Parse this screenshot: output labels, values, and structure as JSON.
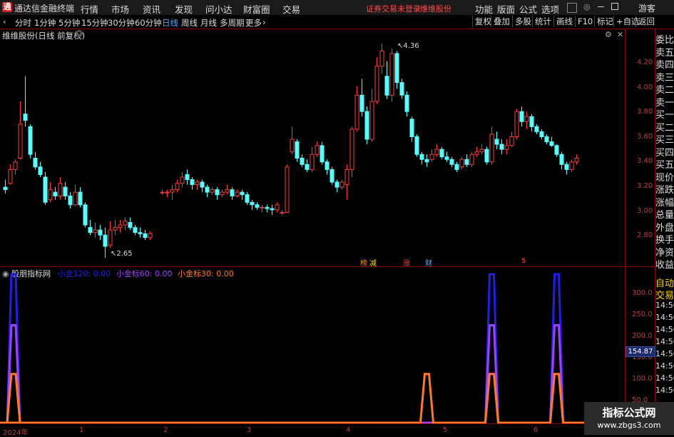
{
  "titlebar": {
    "app_title": "通达信金融终端",
    "menu": [
      "行情",
      "市场",
      "资讯",
      "发现",
      "问小达",
      "财富圈",
      "交易"
    ],
    "status_text": "证券交易未登录",
    "stock_name": "维维股份",
    "right_menu": [
      "功能",
      "版面",
      "公式",
      "选项"
    ],
    "guest": "游客"
  },
  "periods": [
    "分时",
    "1分钟",
    "5分钟",
    "15分钟",
    "30分钟",
    "60分钟",
    "日线",
    "周线",
    "月线",
    "多周期",
    "更多"
  ],
  "active_period": "日线",
  "toolbar_right": [
    "复权",
    "叠加",
    "多股",
    "统计",
    "画线",
    "F10",
    "标记",
    "+自选",
    "返回"
  ],
  "main_chart_title": "维维股份(日线 前复权)",
  "price_axis": [
    "4.20",
    "4.00",
    "3.80",
    "3.60",
    "3.40",
    "3.20",
    "3.00",
    "2.80"
  ],
  "high_label": "4.36",
  "low_label": "2.65",
  "event_tags": [
    {
      "text": "榜",
      "color": "#ff8c00"
    },
    {
      "text": "减",
      "color": "#ffd700"
    },
    {
      "text": "涨",
      "color": "#ff4040"
    },
    {
      "text": "财",
      "color": "#6fa8ff"
    },
    {
      "text": "$",
      "color": "#ff4040"
    }
  ],
  "right_panel": {
    "labels": [
      "委比",
      "卖五",
      "卖四",
      "卖三",
      "卖二",
      "卖一",
      "买一",
      "买二",
      "买三",
      "买四",
      "买五",
      "现价",
      "涨跌",
      "涨幅",
      "总量",
      "外盘",
      "换手",
      "净资",
      "收益"
    ],
    "auto_trade": [
      "自动",
      "交易"
    ],
    "times": [
      "14:56",
      "14:56",
      "14:56",
      "14:56",
      "14:56",
      "14:56",
      "14:56",
      "14:56"
    ]
  },
  "indicator": {
    "name": "股朋指标网",
    "s1_label": "小金120: 0.00",
    "s2_label": "小金标60: 0.00",
    "s3_label": "小金标30: 0.00",
    "axis": [
      "300.0",
      "250.0",
      "200.0",
      "150.0",
      "100.0",
      "50.0"
    ],
    "current_value": "154.87",
    "colors": {
      "s1": "#1e1ef0",
      "s2": "#a040ff",
      "s3": "#ff7a20"
    }
  },
  "x_axis": [
    "2024年",
    "1",
    "2",
    "3",
    "4",
    "5",
    "6"
  ],
  "watermark": {
    "line1": "指标公式网",
    "line2": "www.zbgs3.com"
  },
  "chart_data": {
    "type": "candlestick",
    "title": "维维股份(日线 前复权)",
    "ylim": [
      2.62,
      4.45
    ],
    "candles": [
      [
        3.22,
        3.2,
        3.28,
        3.17
      ],
      [
        3.25,
        3.36,
        3.4,
        3.24
      ],
      [
        3.36,
        3.42,
        3.44,
        3.32
      ],
      [
        3.45,
        3.72,
        3.9,
        3.44
      ],
      [
        3.8,
        3.75,
        4.1,
        3.7
      ],
      [
        3.7,
        3.48,
        3.72,
        3.45
      ],
      [
        3.45,
        3.38,
        3.5,
        3.36
      ],
      [
        3.38,
        3.32,
        3.42,
        3.3
      ],
      [
        3.3,
        3.1,
        3.34,
        3.08
      ],
      [
        3.12,
        3.2,
        3.26,
        3.1
      ],
      [
        3.18,
        3.15,
        3.22,
        3.12
      ],
      [
        3.15,
        3.25,
        3.3,
        3.12
      ],
      [
        3.22,
        3.15,
        3.26,
        3.12
      ],
      [
        3.15,
        3.08,
        3.18,
        3.05
      ],
      [
        3.08,
        3.18,
        3.24,
        3.07
      ],
      [
        3.18,
        3.08,
        3.22,
        3.06
      ],
      [
        3.08,
        2.92,
        3.1,
        2.9
      ],
      [
        2.9,
        2.86,
        2.96,
        2.84
      ],
      [
        2.86,
        2.88,
        2.94,
        2.82
      ],
      [
        2.88,
        2.84,
        2.92,
        2.8
      ],
      [
        2.84,
        2.75,
        2.9,
        2.66
      ],
      [
        2.76,
        2.88,
        2.95,
        2.74
      ],
      [
        2.88,
        2.9,
        2.96,
        2.84
      ],
      [
        2.9,
        2.92,
        2.96,
        2.86
      ],
      [
        2.92,
        2.95,
        2.98,
        2.88
      ],
      [
        2.94,
        2.9,
        2.98,
        2.88
      ],
      [
        2.9,
        2.86,
        2.92,
        2.84
      ],
      [
        2.86,
        2.85,
        2.9,
        2.82
      ],
      [
        2.85,
        2.82,
        2.88,
        2.8
      ],
      [
        2.82,
        2.85,
        2.87,
        2.8
      ],
      [
        3.18,
        3.18,
        3.2,
        3.16
      ],
      [
        3.18,
        3.18,
        3.2,
        3.14
      ],
      [
        3.18,
        3.2,
        3.24,
        3.12
      ],
      [
        3.2,
        3.25,
        3.28,
        3.18
      ],
      [
        3.25,
        3.3,
        3.34,
        3.22
      ],
      [
        3.32,
        3.28,
        3.36,
        3.24
      ],
      [
        3.28,
        3.24,
        3.3,
        3.2
      ],
      [
        3.24,
        3.26,
        3.28,
        3.2
      ],
      [
        3.26,
        3.22,
        3.28,
        3.18
      ],
      [
        3.22,
        3.18,
        3.24,
        3.14
      ],
      [
        3.18,
        3.2,
        3.22,
        3.16
      ],
      [
        3.2,
        3.16,
        3.22,
        3.12
      ],
      [
        3.16,
        3.18,
        3.2,
        3.14
      ],
      [
        3.18,
        3.2,
        3.24,
        3.16
      ],
      [
        3.2,
        3.15,
        3.22,
        3.12
      ],
      [
        3.15,
        3.18,
        3.2,
        3.14
      ],
      [
        3.18,
        3.16,
        3.2,
        3.12
      ],
      [
        3.16,
        3.1,
        3.18,
        3.08
      ],
      [
        3.1,
        3.08,
        3.12,
        3.04
      ],
      [
        3.08,
        3.06,
        3.1,
        3.04
      ],
      [
        3.06,
        3.06,
        3.08,
        3.02
      ],
      [
        3.06,
        3.05,
        3.08,
        3.02
      ],
      [
        3.05,
        3.04,
        3.08,
        3.0
      ],
      [
        3.04,
        3.08,
        3.1,
        3.02
      ],
      [
        3.02,
        3.02,
        3.04,
        3.0
      ],
      [
        3.02,
        3.38,
        3.4,
        3.02
      ],
      [
        3.5,
        3.6,
        3.7,
        3.48
      ],
      [
        3.58,
        3.45,
        3.6,
        3.42
      ],
      [
        3.45,
        3.4,
        3.48,
        3.38
      ],
      [
        3.4,
        3.36,
        3.44,
        3.34
      ],
      [
        3.36,
        3.48,
        3.54,
        3.34
      ],
      [
        3.48,
        3.55,
        3.58,
        3.46
      ],
      [
        3.55,
        3.42,
        3.58,
        3.4
      ],
      [
        3.42,
        3.36,
        3.44,
        3.32
      ],
      [
        3.36,
        3.26,
        3.38,
        3.24
      ],
      [
        3.26,
        3.22,
        3.28,
        3.18
      ],
      [
        3.22,
        3.26,
        3.28,
        3.2
      ],
      [
        3.24,
        3.36,
        3.4,
        3.12
      ],
      [
        3.36,
        3.68,
        3.7,
        3.3
      ],
      [
        3.68,
        3.95,
        4.02,
        3.66
      ],
      [
        3.95,
        3.82,
        4.08,
        3.78
      ],
      [
        3.82,
        3.6,
        3.86,
        3.56
      ],
      [
        3.6,
        3.9,
        4.0,
        3.58
      ],
      [
        3.9,
        4.18,
        4.25,
        3.88
      ],
      [
        4.18,
        4.3,
        4.36,
        4.12
      ],
      [
        4.1,
        3.95,
        4.22,
        3.92
      ],
      [
        3.95,
        4.28,
        4.32,
        3.9
      ],
      [
        4.28,
        4.05,
        4.3,
        4.0
      ],
      [
        4.05,
        3.95,
        4.08,
        3.92
      ],
      [
        3.95,
        3.82,
        3.98,
        3.78
      ],
      [
        3.76,
        3.62,
        3.78,
        3.58
      ],
      [
        3.62,
        3.48,
        3.64,
        3.46
      ],
      [
        3.48,
        3.44,
        3.5,
        3.4
      ],
      [
        3.44,
        3.42,
        3.48,
        3.38
      ],
      [
        3.44,
        3.48,
        3.52,
        3.42
      ],
      [
        3.48,
        3.52,
        3.56,
        3.46
      ],
      [
        3.52,
        3.46,
        3.54,
        3.44
      ],
      [
        3.46,
        3.44,
        3.5,
        3.42
      ],
      [
        3.44,
        3.4,
        3.46,
        3.38
      ],
      [
        3.4,
        3.36,
        3.42,
        3.34
      ],
      [
        3.38,
        3.44,
        3.46,
        3.36
      ],
      [
        3.44,
        3.4,
        3.48,
        3.38
      ],
      [
        3.4,
        3.48,
        3.5,
        3.38
      ],
      [
        3.48,
        3.5,
        3.54,
        3.46
      ],
      [
        3.5,
        3.52,
        3.56,
        3.48
      ],
      [
        3.52,
        3.42,
        3.54,
        3.4
      ],
      [
        3.42,
        3.64,
        3.7,
        3.4
      ],
      [
        3.6,
        3.56,
        3.66,
        3.52
      ],
      [
        3.56,
        3.52,
        3.6,
        3.48
      ],
      [
        3.52,
        3.55,
        3.6,
        3.48
      ],
      [
        3.55,
        3.62,
        3.66,
        3.54
      ],
      [
        3.62,
        3.82,
        3.84,
        3.6
      ],
      [
        3.82,
        3.74,
        3.86,
        3.7
      ],
      [
        3.74,
        3.78,
        3.82,
        3.68
      ],
      [
        3.78,
        3.7,
        3.8,
        3.66
      ],
      [
        3.7,
        3.66,
        3.72,
        3.64
      ],
      [
        3.66,
        3.62,
        3.68,
        3.6
      ],
      [
        3.62,
        3.58,
        3.64,
        3.56
      ],
      [
        3.58,
        3.55,
        3.62,
        3.54
      ],
      [
        3.55,
        3.48,
        3.56,
        3.46
      ],
      [
        3.48,
        3.4,
        3.5,
        3.36
      ],
      [
        3.4,
        3.36,
        3.42,
        3.32
      ],
      [
        3.36,
        3.42,
        3.44,
        3.34
      ],
      [
        3.42,
        3.45,
        3.48,
        3.4
      ]
    ],
    "indicator_series": [
      {
        "name": "小金120",
        "ylim": [
          0,
          340
        ],
        "spikes": [
          [
            0,
            0,
            335
          ],
          [
            1,
            0,
            335
          ],
          [
            96,
            0,
            335
          ],
          [
            109,
            0,
            335
          ]
        ]
      },
      {
        "name": "小金标60",
        "ylim": [
          0,
          340
        ],
        "spikes": [
          [
            0,
            0,
            220
          ],
          [
            1,
            0,
            220
          ],
          [
            96,
            0,
            220
          ],
          [
            109,
            0,
            220
          ]
        ]
      },
      {
        "name": "小金标30",
        "ylim": [
          0,
          340
        ],
        "spikes": [
          [
            0,
            0,
            110
          ],
          [
            1,
            0,
            110
          ],
          [
            83,
            0,
            110
          ],
          [
            96,
            0,
            110
          ],
          [
            109,
            0,
            110
          ]
        ]
      }
    ]
  }
}
